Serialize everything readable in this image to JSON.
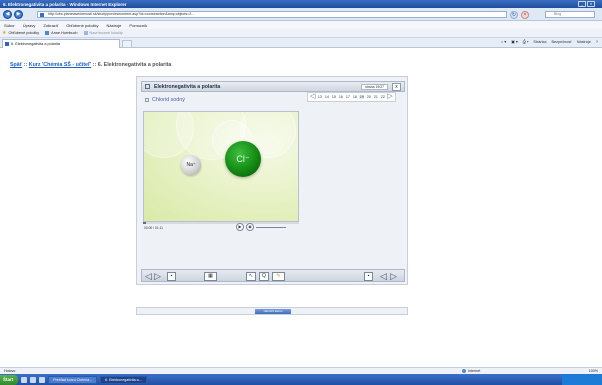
{
  "window": {
    "title": "6. Elektronegativita a polarita - Windows Internet Explorer",
    "min_glyph": "_",
    "max_glyph": "□",
    "close_glyph": "x"
  },
  "address": {
    "url": "http://cbn.planetavedomosti.sk/study/previewcontent.asp?id=courseaction&amp;objects=2...",
    "search_text": "Bing"
  },
  "menu": [
    "Súbor",
    "Úpravy",
    "Zobraziť",
    "Obľúbené položky",
    "Nástroje",
    "Pomocník"
  ],
  "favorites": {
    "label": "Obľúbené položky",
    "links": [
      "Anne Hornbuch",
      "Navrhované lokality"
    ]
  },
  "tab": {
    "label": "6. Elektronegativita a polarita"
  },
  "toolbar_right": [
    "Stránka",
    "Bezpečnosť",
    "Nástroje"
  ],
  "breadcrumb": {
    "back": "Späť",
    "sep1": " :: ",
    "course": "Kurz 'Chémia SŠ - učiteľ'",
    "sep2": " :: ",
    "current": "6. Elektronegativita a polarita"
  },
  "player": {
    "title": "Elektronegativita a polarita",
    "status": "strana 19/27",
    "close": "x",
    "slide_title": "Chlorid sodný",
    "pages": [
      "13",
      "14",
      "15",
      "16",
      "17",
      "18",
      "19",
      "20",
      "21",
      "22"
    ],
    "current_page": "19",
    "atom_left": "Na⁺",
    "atom_right": "Cl⁻",
    "timecode": "00:00 / 01:11",
    "progress": 0.02
  },
  "footer": {
    "button": "Ukončiť lekciu"
  },
  "statusbar": {
    "left": "Hotovo",
    "zone": "Internet",
    "zoom": "100%"
  },
  "taskbar": {
    "start": "Štart",
    "items": [
      "Prehľad kurzu Chémia...",
      "6. Elektronegativita a..."
    ]
  }
}
